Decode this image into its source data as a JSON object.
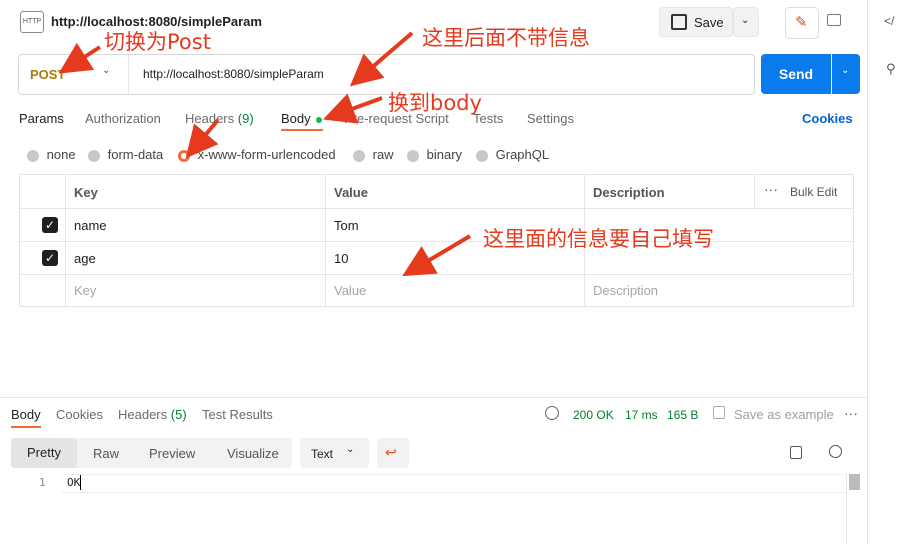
{
  "request": {
    "title": "http://localhost:8080/simpleParam",
    "method": "POST",
    "url": "http://localhost:8080/simpleParam",
    "http_badge": "HTTP",
    "save_label": "Save",
    "send_label": "Send"
  },
  "tabs": {
    "params": "Params",
    "authorization": "Authorization",
    "headers": "Headers",
    "headers_count": "(9)",
    "body": "Body",
    "pre_request": "Pre-request Script",
    "tests": "Tests",
    "settings": "Settings",
    "cookies": "Cookies"
  },
  "body_types": [
    "none",
    "form-data",
    "x-www-form-urlencoded",
    "raw",
    "binary",
    "GraphQL"
  ],
  "table": {
    "headers": {
      "key": "Key",
      "value": "Value",
      "description": "Description",
      "bulk_edit": "Bulk Edit"
    },
    "rows": [
      {
        "key": "name",
        "value": "Tom",
        "description": ""
      },
      {
        "key": "age",
        "value": "10",
        "description": ""
      }
    ],
    "placeholder": {
      "key": "Key",
      "value": "Value",
      "description": "Description"
    }
  },
  "response": {
    "tabs": {
      "body": "Body",
      "cookies": "Cookies",
      "headers": "Headers",
      "headers_count": "(5)",
      "test_results": "Test Results"
    },
    "status": "200 OK",
    "time": "17 ms",
    "size": "165 B",
    "save_example": "Save as example",
    "views": [
      "Pretty",
      "Raw",
      "Preview",
      "Visualize"
    ],
    "format": "Text",
    "line_no": "1",
    "content": "OK"
  },
  "annotations": {
    "switch_post": "切换为Post",
    "no_info_after": "这里后面不带信息",
    "to_body": "换到body",
    "fill_info": "这里面的信息要自己填写"
  },
  "colors": {
    "accent": "#f26b3a",
    "send": "#097bed",
    "status": "#007f31",
    "annotation": "#e63a1f",
    "link": "#0265d2"
  }
}
